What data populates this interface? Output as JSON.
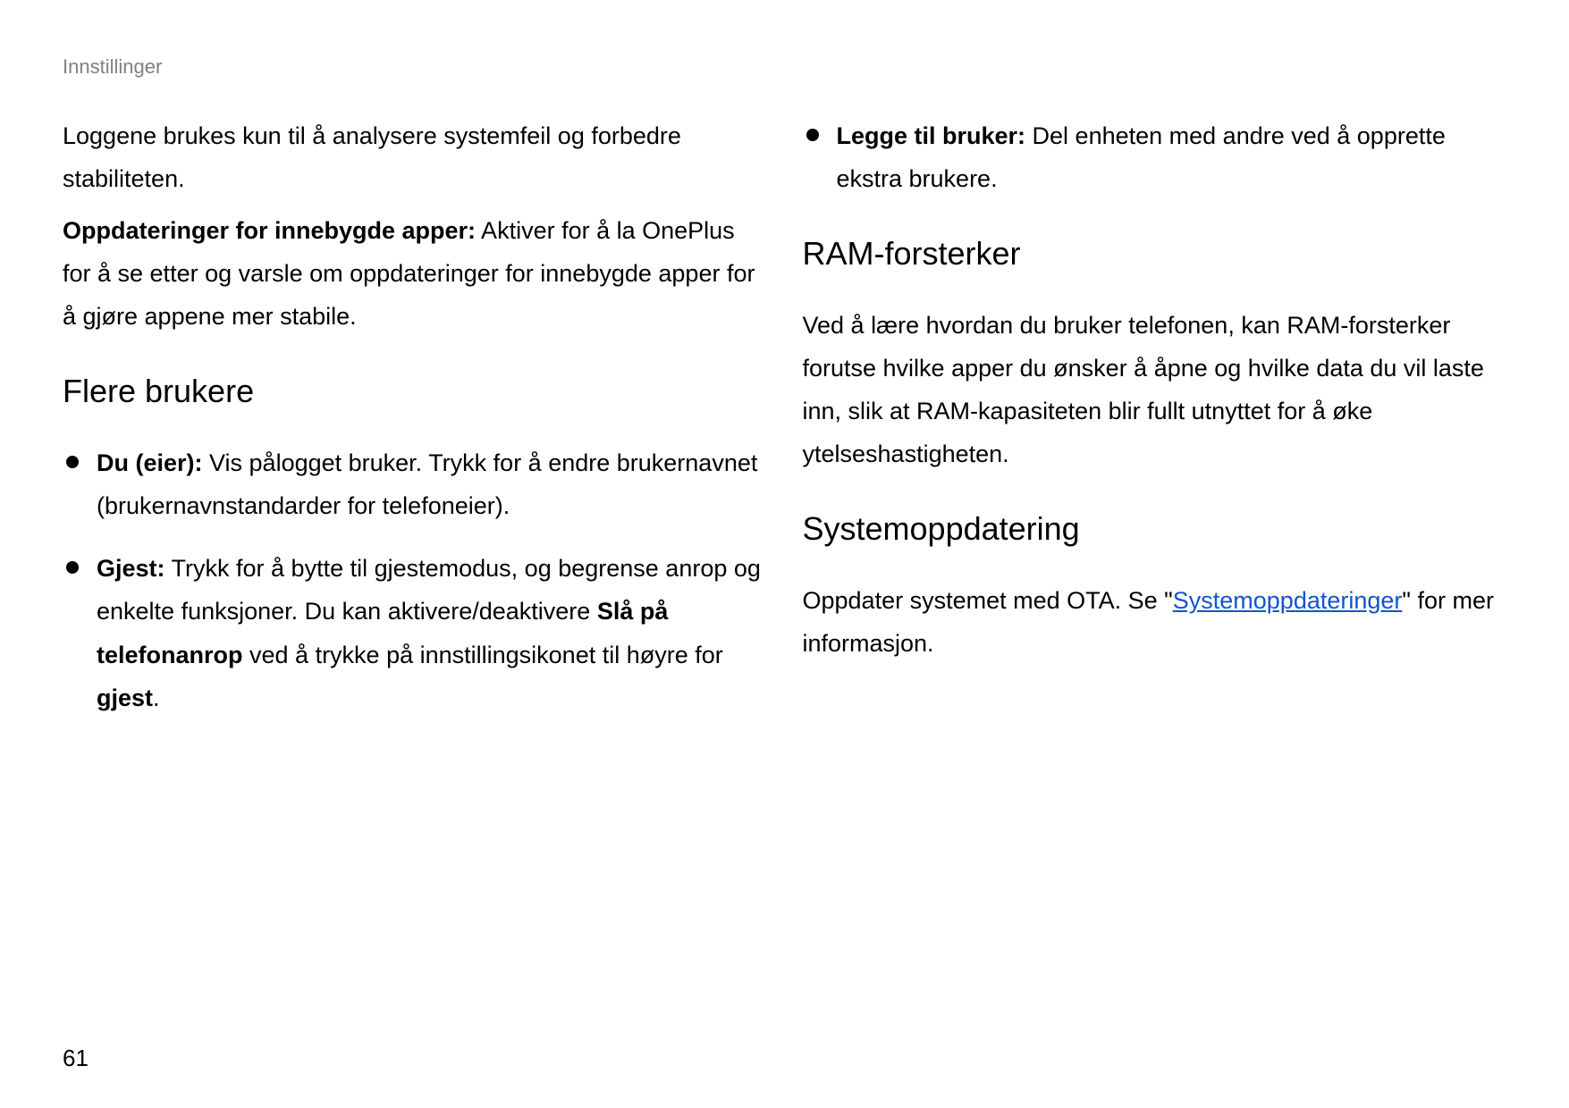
{
  "header": "Innstillinger",
  "page_number": "61",
  "left": {
    "intro": "Loggene brukes kun til å analysere systemfeil og forbedre stabiliteten.",
    "builtin_label": "Oppdateringer for innebygde apper:",
    "builtin_text": " Aktiver for å la OnePlus for å se etter og varsle om oppdateringer for innebygde apper for å gjøre appene mer stabile.",
    "heading_users": "Flere brukere",
    "bullets": [
      {
        "label": "Du (eier):",
        "text": " Vis pålogget bruker. Trykk for å endre brukernavnet (brukernavnstandarder for telefoneier)."
      },
      {
        "label": "Gjest:",
        "pre": " Trykk for å bytte til gjestemodus, og begrense anrop og enkelte funksjoner. Du kan aktivere/deaktivere ",
        "bold_phrase": "Slå på telefonanrop",
        "mid": " ved å trykke på innstillingsikonet til høyre for ",
        "bold_end": "gjest",
        "tail": "."
      }
    ]
  },
  "right": {
    "bullets": [
      {
        "label": "Legge til bruker:",
        "text": " Del enheten med andre ved å opprette ekstra brukere."
      }
    ],
    "heading_ram": "RAM-forsterker",
    "ram_text": "Ved å lære hvordan du bruker telefonen, kan RAM-forsterker forutse hvilke apper du ønsker å åpne og hvilke data du vil laste inn, slik at RAM-kapasiteten blir fullt utnyttet for å øke ytelseshastigheten.",
    "heading_system": "Systemoppdatering",
    "system_pre": "Oppdater systemet med OTA. Se \"",
    "system_link": "Systemoppdateringer",
    "system_post": "\" for mer informasjon."
  }
}
